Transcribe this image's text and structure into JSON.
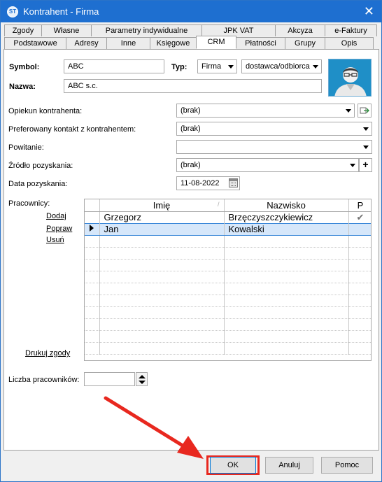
{
  "window": {
    "title": "Kontrahent - Firma",
    "icon_text": "ST",
    "close_glyph": "✕"
  },
  "tabs_row1": [
    {
      "label": "Zgody"
    },
    {
      "label": "Własne"
    },
    {
      "label": "Parametry indywidualne"
    },
    {
      "label": "JPK VAT"
    },
    {
      "label": "Akcyza"
    },
    {
      "label": "e-Faktury"
    }
  ],
  "tabs_row2": [
    {
      "label": "Podstawowe"
    },
    {
      "label": "Adresy"
    },
    {
      "label": "Inne"
    },
    {
      "label": "Księgowe"
    },
    {
      "label": "CRM",
      "active": true
    },
    {
      "label": "Płatności"
    },
    {
      "label": "Grupy"
    },
    {
      "label": "Opis"
    }
  ],
  "header": {
    "symbol_label": "Symbol:",
    "symbol_value": "ABC",
    "typ_label": "Typ:",
    "typ_value": "Firma",
    "typ2_value": "dostawca/odbiorca",
    "nazwa_label": "Nazwa:",
    "nazwa_value": "ABC s.c."
  },
  "crm": {
    "opiekun_label": "Opiekun kontrahenta:",
    "opiekun_value": "(brak)",
    "kontakt_label": "Preferowany kontakt z kontrahentem:",
    "kontakt_value": "(brak)",
    "powitanie_label": "Powitanie:",
    "powitanie_value": "",
    "zrodlo_label": "Źródło pozyskania:",
    "zrodlo_value": "(brak)",
    "zrodlo_add": "+",
    "data_label": "Data pozyskania:",
    "data_value": "11-08-2022"
  },
  "pracownicy": {
    "label": "Pracownicy:",
    "actions": {
      "dodaj": "Dodaj",
      "popraw": "Popraw",
      "usun": "Usuń",
      "drukuj": "Drukuj zgody"
    },
    "columns": [
      "Imię",
      "Nazwisko",
      "P"
    ],
    "rows": [
      {
        "imie": "Grzegorz",
        "nazwisko": "Brzęczyszczykiewicz",
        "p": "✔",
        "selected": false
      },
      {
        "imie": "Jan",
        "nazwisko": "Kowalski",
        "p": "",
        "selected": true
      }
    ],
    "empty_rows": 10
  },
  "liczba": {
    "label": "Liczba pracowników:",
    "value": ""
  },
  "buttons": {
    "ok": "OK",
    "anuluj": "Anuluj",
    "pomoc": "Pomoc"
  },
  "colors": {
    "titlebar": "#1e6fd0",
    "highlight": "#e8281f",
    "selection": "#d6e7fa"
  }
}
